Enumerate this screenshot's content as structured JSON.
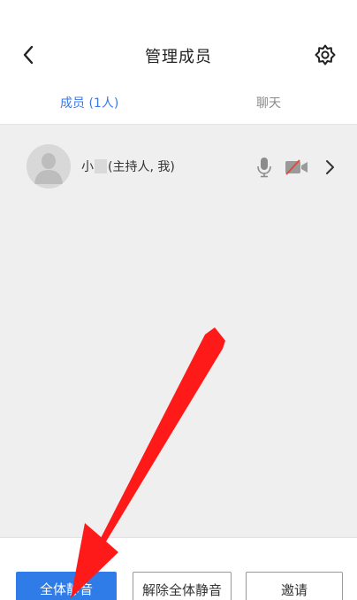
{
  "header": {
    "title": "管理成员",
    "back_icon": "chevron-left-icon",
    "settings_icon": "gear-icon"
  },
  "tabs": [
    {
      "label": "成员 (1人)",
      "active": true
    },
    {
      "label": "聊天",
      "active": false
    }
  ],
  "members": [
    {
      "name_prefix": "小",
      "name_suffix": "(主持人, 我)",
      "mic": "microphone-icon",
      "camera": "camera-off-icon",
      "action": "chevron-right-icon"
    }
  ],
  "footer": {
    "mute_all": "全体静音",
    "unmute_all": "解除全体静音",
    "invite": "邀请"
  },
  "colors": {
    "accent": "#2f7be8",
    "tab_active": "#3a78e6",
    "camera_off": "#e04a3a",
    "annotation_arrow": "#ff1a1a"
  }
}
